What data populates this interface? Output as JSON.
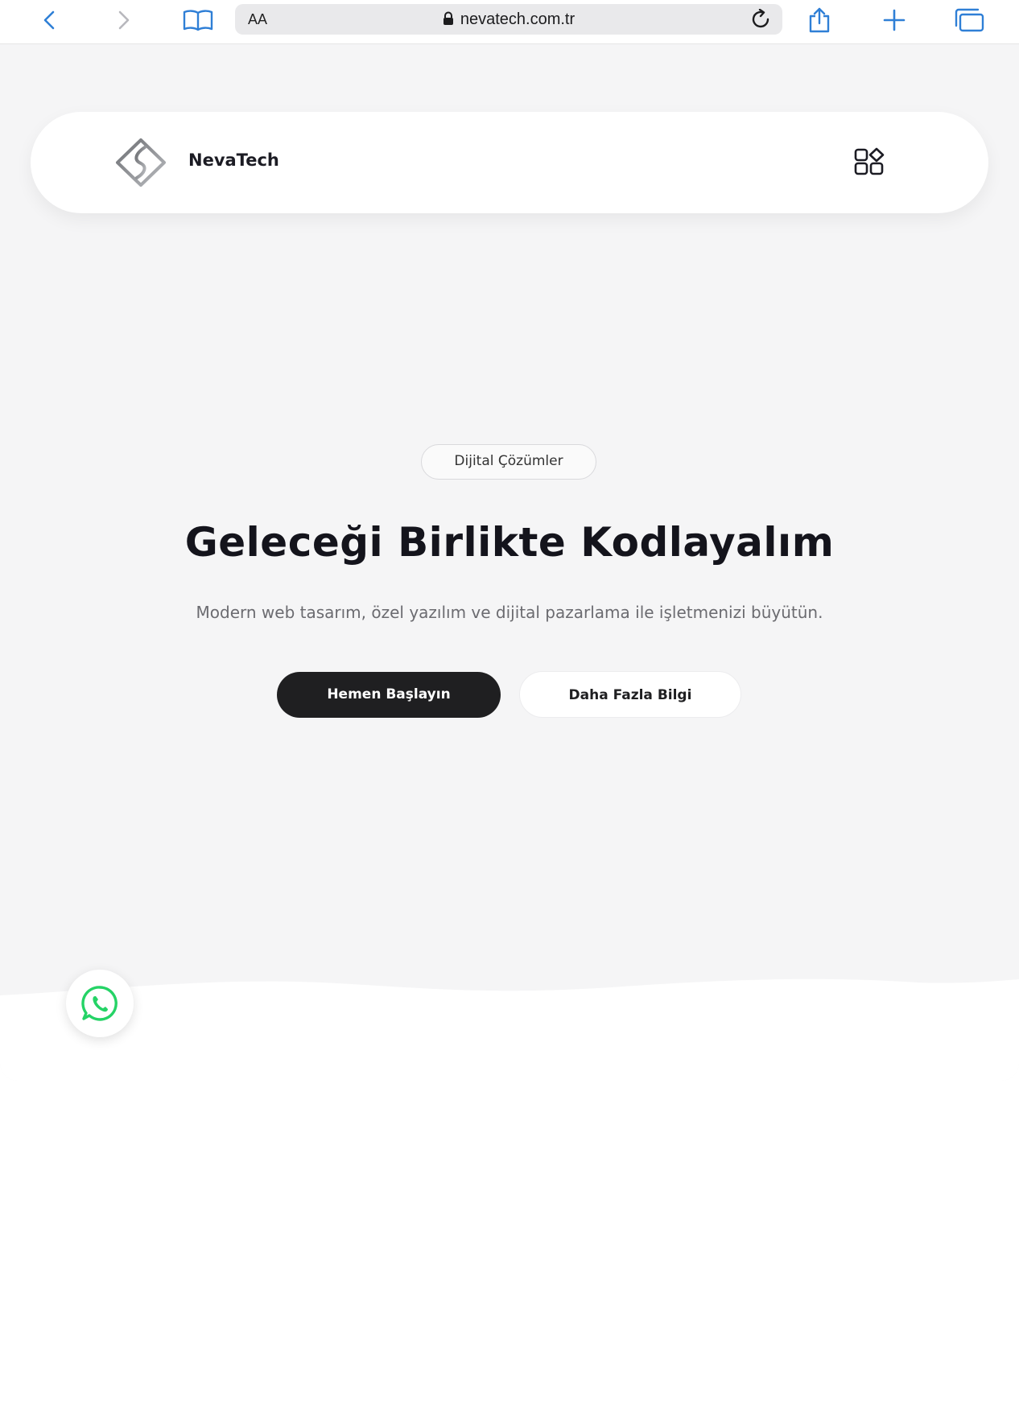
{
  "browser": {
    "text_size_label": "AA",
    "url": "nevatech.com.tr",
    "accent_color": "#2f7fd6"
  },
  "header": {
    "brand": "NevaTech"
  },
  "hero": {
    "badge": "Dijital Çözümler",
    "title": "Geleceği Birlikte Kodlayalım",
    "subtitle": "Modern web tasarım, özel yazılım ve dijital pazarlama ile işletmenizi büyütün.",
    "primary_button": "Hemen Başlayın",
    "secondary_button": "Daha Fazla Bilgi"
  },
  "floating": {
    "whatsapp_icon": "whatsapp-icon",
    "whatsapp_color": "#25d366"
  }
}
